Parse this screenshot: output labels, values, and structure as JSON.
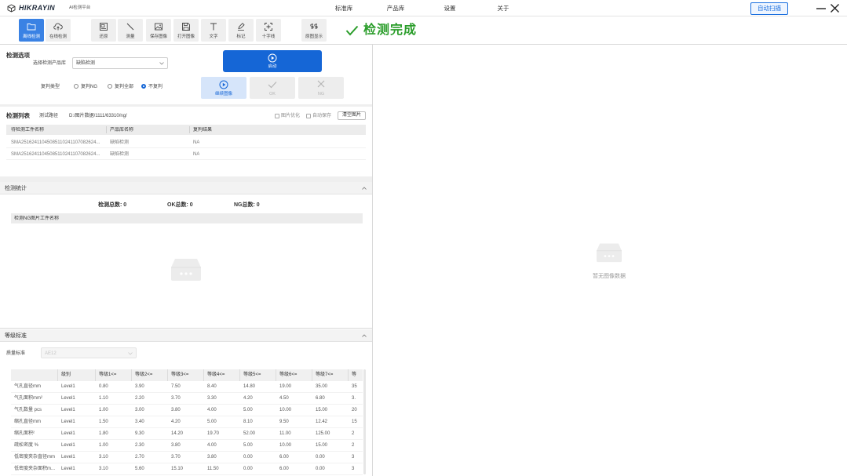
{
  "app": {
    "logo": "HIKRAYIN",
    "subtitle": "AI检测平台",
    "logo_icon": "cube-logo-icon"
  },
  "nav": {
    "items": [
      "标准库",
      "产品库",
      "设置",
      "关于"
    ]
  },
  "window_controls": {
    "auto_scan": "自动扫描",
    "minimize_icon": "minimize-icon",
    "close_icon": "close-icon"
  },
  "toolbar": {
    "items": [
      {
        "label": "离线检测",
        "icon": "folder-icon",
        "active": true
      },
      {
        "label": "在线检测",
        "icon": "cloud-upload-icon",
        "active": false
      },
      {
        "label": "还原",
        "icon": "restore-icon",
        "active": false
      },
      {
        "label": "测量",
        "icon": "measure-line-icon",
        "active": false
      },
      {
        "label": "保存图像",
        "icon": "save-image-icon",
        "active": false
      },
      {
        "label": "打开图像",
        "icon": "open-image-icon",
        "active": false
      },
      {
        "label": "文字",
        "icon": "text-icon",
        "active": false
      },
      {
        "label": "标记",
        "icon": "marker-icon",
        "active": false
      },
      {
        "label": "十字线",
        "icon": "crosshair-icon",
        "active": false
      },
      {
        "label": "原图显示",
        "icon": "original-image-icon",
        "active": false
      }
    ],
    "status": {
      "icon": "check-icon",
      "text": "检测完成"
    }
  },
  "detection_options": {
    "title": "检测选项",
    "product_label": "选择检测产品库",
    "product_value": "缺陷检测",
    "start_label": "启动",
    "review_label": "复判类型",
    "review_options": [
      {
        "label": "复判NG",
        "checked": false
      },
      {
        "label": "复判全部",
        "checked": false
      },
      {
        "label": "不复判",
        "checked": true
      }
    ],
    "continue_label": "继续图像",
    "ok_label": "OK",
    "ng_label": "NG"
  },
  "detection_list": {
    "title": "检测列表",
    "path_label": "测试路径",
    "path_value": "D:/图片数据/1111/63310/ng/",
    "options": [
      {
        "label": "图片优化",
        "checked": false
      },
      {
        "label": "自动保存",
        "checked": false
      }
    ],
    "clear_label": "清空图片",
    "columns": [
      "待检测工件名称",
      "产品库名称",
      "复判结果"
    ],
    "rows": [
      [
        "SMA25162411045085110241107082624...",
        "缺陷检测",
        "NA"
      ],
      [
        "SMA25162411045085110241107082624...",
        "缺陷检测",
        "NA"
      ]
    ]
  },
  "detection_stats": {
    "title": "检测统计",
    "total": {
      "label": "检测总数:",
      "value": "0"
    },
    "ok": {
      "label": "OK总数:",
      "value": "0"
    },
    "ng": {
      "label": "NG总数:",
      "value": "0"
    },
    "ng_table_header": "检测NG图片工件名称"
  },
  "grade_standard": {
    "title": "等级标准",
    "quality_label": "质量标准",
    "quality_value": "AE12",
    "quality_disabled": true,
    "columns": [
      "",
      "级别",
      "等级1<=",
      "等级2<=",
      "等级3<=",
      "等级4<=",
      "等级5<=",
      "等级6<=",
      "等级7<=",
      "等"
    ],
    "rows": [
      [
        "气孔直径mm",
        "Level1",
        "0.80",
        "3.90",
        "7.50",
        "8.40",
        "14.80",
        "19.00",
        "35.00",
        "35"
      ],
      [
        "气孔面积mm²",
        "Level1",
        "1.10",
        "2.20",
        "3.70",
        "3.30",
        "4.20",
        "4.50",
        "6.80",
        "3."
      ],
      [
        "气孔数量 pcs",
        "Level1",
        "1.00",
        "3.00",
        "3.80",
        "4.00",
        "5.00",
        "10.00",
        "15.00",
        "20"
      ],
      [
        "缩孔直径mm",
        "Level1",
        "1.50",
        "3.40",
        "4.20",
        "5.00",
        "8.10",
        "9.50",
        "12.42",
        "15"
      ],
      [
        "缩孔面积²",
        "Level1",
        "1.80",
        "9.30",
        "14.20",
        "19.70",
        "52.00",
        "11.00",
        "125.00",
        "2"
      ],
      [
        "疏松密度 %",
        "Level1",
        "1.00",
        "2.30",
        "3.80",
        "4.00",
        "5.00",
        "10.00",
        "15.00",
        "2"
      ],
      [
        "低密度夹杂直径mm",
        "Level1",
        "3.10",
        "2.70",
        "3.70",
        "3.80",
        "0.00",
        "6.00",
        "0.00",
        "3"
      ],
      [
        "低密度夹杂面积m...",
        "Level1",
        "3.10",
        "5.60",
        "15.10",
        "11.50",
        "0.00",
        "6.00",
        "0.00",
        "3"
      ]
    ]
  },
  "image_viewer": {
    "empty_text": "暂无图像数据",
    "empty_icon": "empty-box-icon"
  },
  "colors": {
    "accent": "#1566d6",
    "active_tool": "#3a82e4",
    "success": "#2a9d2a",
    "continue_button": "#d6e5fa"
  }
}
